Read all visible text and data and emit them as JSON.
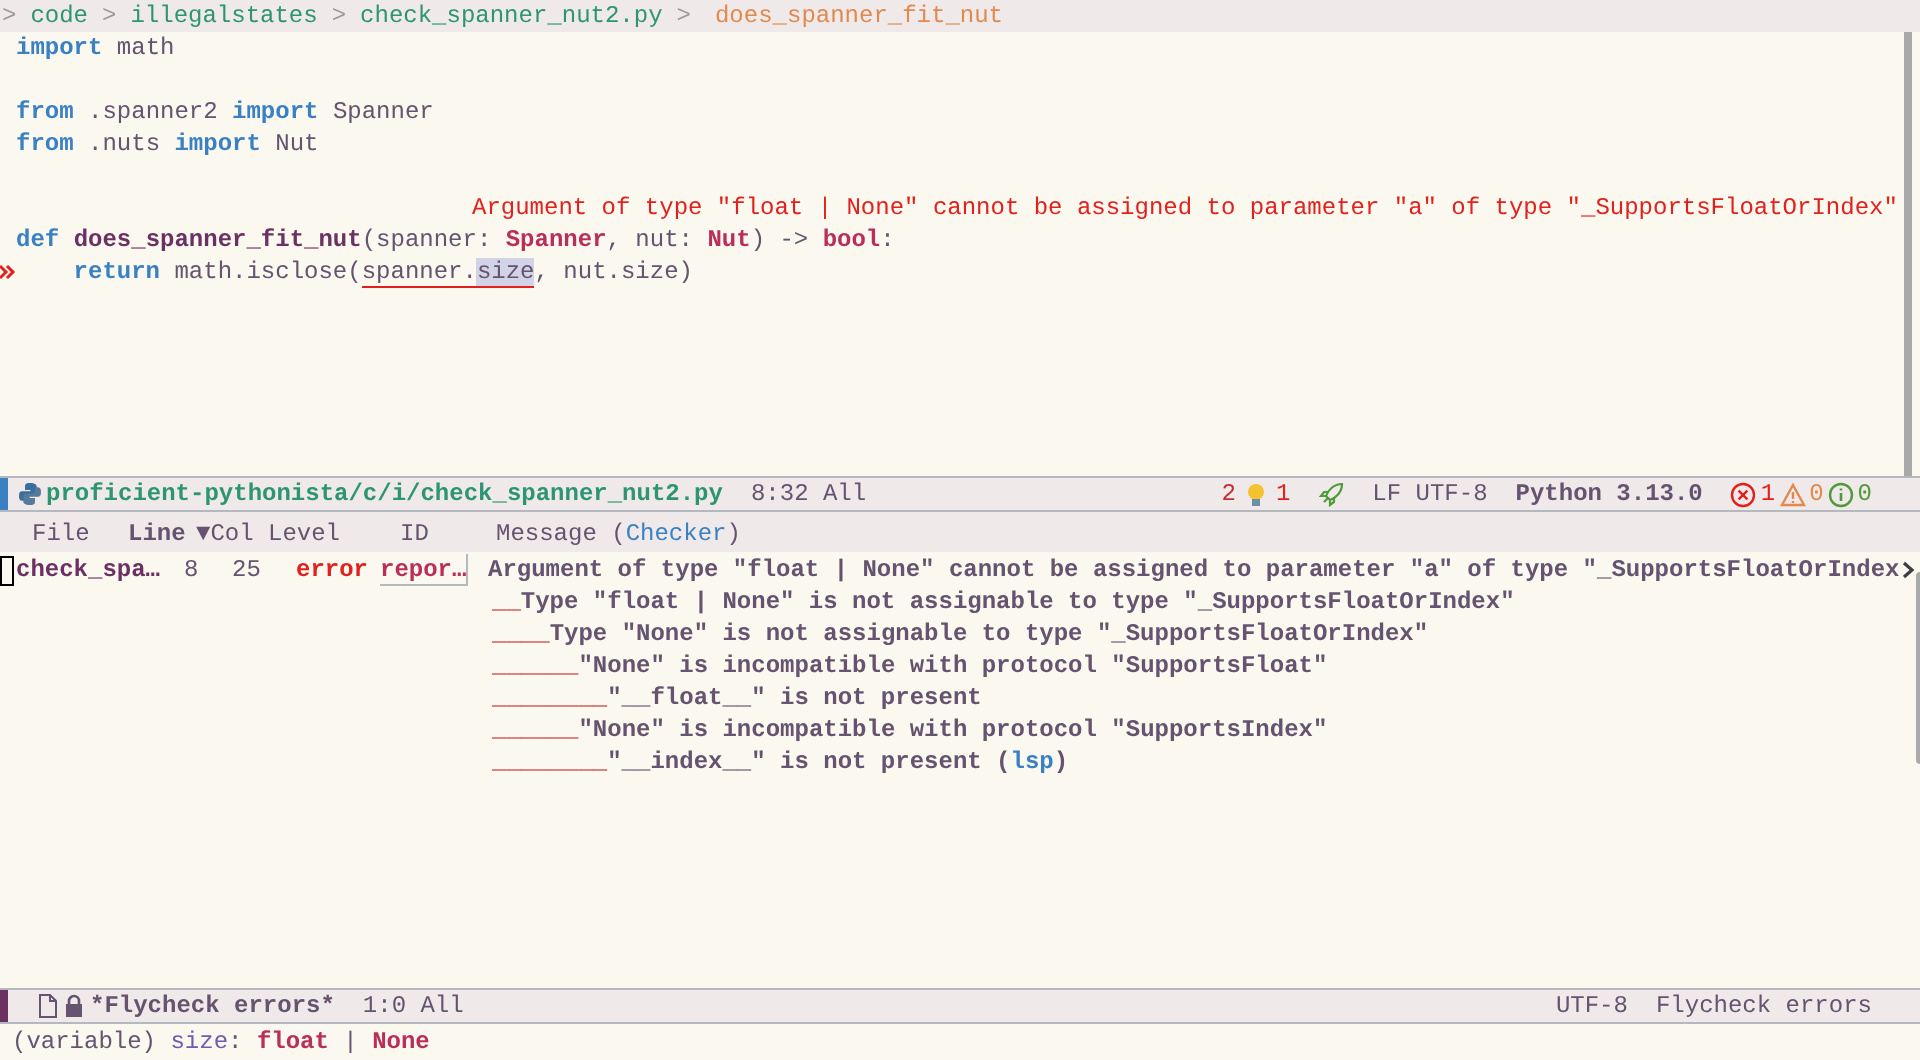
{
  "breadcrumb": [
    {
      "text": ">",
      "kind": "sep"
    },
    {
      "text": "code",
      "kind": "dir"
    },
    {
      "text": ">",
      "kind": "sep"
    },
    {
      "text": "illegalstates",
      "kind": "dir"
    },
    {
      "text": ">",
      "kind": "sep"
    },
    {
      "text": "check_spanner_nut2.py",
      "kind": "dir"
    },
    {
      "text": ">",
      "kind": "sep"
    },
    {
      "text": "does_spanner_fit_nut",
      "kind": "symbol"
    }
  ],
  "code": [
    {
      "kind": "code",
      "marker": false,
      "tokens": [
        {
          "text": "import",
          "kind": "keyword"
        },
        {
          "text": " math",
          "kind": "plain"
        }
      ]
    },
    {
      "kind": "blank"
    },
    {
      "kind": "code",
      "marker": false,
      "tokens": [
        {
          "text": "from",
          "kind": "keyword"
        },
        {
          "text": " .spanner2 ",
          "kind": "plain"
        },
        {
          "text": "import",
          "kind": "keyword"
        },
        {
          "text": " Spanner",
          "kind": "plain"
        }
      ]
    },
    {
      "kind": "code",
      "marker": false,
      "tokens": [
        {
          "text": "from",
          "kind": "keyword"
        },
        {
          "text": " .nuts ",
          "kind": "plain"
        },
        {
          "text": "import",
          "kind": "keyword"
        },
        {
          "text": " Nut",
          "kind": "plain"
        }
      ]
    },
    {
      "kind": "blank"
    },
    {
      "kind": "overlay",
      "text": "Argument of type \"float | None\" cannot be assigned to parameter \"a\" of type \"_SupportsFloatOrIndex\""
    },
    {
      "kind": "code",
      "marker": false,
      "tokens": [
        {
          "text": "def ",
          "kind": "keyword"
        },
        {
          "text": "does_spanner_fit_nut",
          "kind": "function"
        },
        {
          "text": "(spanner: ",
          "kind": "plain"
        },
        {
          "text": "Spanner",
          "kind": "type"
        },
        {
          "text": ", nut: ",
          "kind": "plain"
        },
        {
          "text": "Nut",
          "kind": "type"
        },
        {
          "text": ") -> ",
          "kind": "plain"
        },
        {
          "text": "bool",
          "kind": "type"
        },
        {
          "text": ":",
          "kind": "plain"
        }
      ]
    },
    {
      "kind": "code",
      "marker": true,
      "tokens": [
        {
          "text": "    return",
          "kind": "keyword"
        },
        {
          "text": " math.isclose(",
          "kind": "plain"
        },
        {
          "text": "spanner.",
          "kind": "plain",
          "underlined": true,
          "highlighted": false
        },
        {
          "text": "size",
          "kind": "plain",
          "underlined": true,
          "highlighted": true
        },
        {
          "text": ", nut.size)",
          "kind": "plain"
        }
      ]
    }
  ],
  "mode_line": {
    "path": "proficient-pythonista/c/i/check_spanner_nut2.py",
    "position": "8:32 All",
    "hints": "2",
    "actions": "1",
    "eol_encoding": "LF UTF-8",
    "interpreter": "Python 3.13.0",
    "errors": "1",
    "warnings": "0",
    "infos": "0"
  },
  "table": {
    "columns": [
      {
        "label": "File",
        "bold": false
      },
      {
        "label": "Line",
        "bold": true
      },
      {
        "label": "Col",
        "bold": false,
        "sort": "▼"
      },
      {
        "label": "Level",
        "bold": false
      },
      {
        "label": "ID",
        "bold": false
      }
    ],
    "message_column": [
      {
        "text": "Message (",
        "kind": "header"
      },
      {
        "text": "Checker",
        "kind": "link"
      },
      {
        "text": ")",
        "kind": "header"
      }
    ],
    "rows": [
      {
        "file": "check_spa…",
        "line": "8",
        "col": "25",
        "level": "error",
        "id": "repor…",
        "message": "Argument of type \"float | None\" cannot be assigned to parameter \"a\" of type \"_SupportsFloatOrIndex",
        "truncated": true,
        "details": [
          {
            "indent": "__",
            "parts": [
              {
                "text": "Type \"float | None\" is not assignable to type \"_SupportsFloatOrIndex\"",
                "kind": "text"
              }
            ]
          },
          {
            "indent": "____",
            "parts": [
              {
                "text": "Type \"None\" is not assignable to type \"_SupportsFloatOrIndex\"",
                "kind": "text"
              }
            ]
          },
          {
            "indent": "______",
            "parts": [
              {
                "text": "\"None\" is incompatible with protocol \"SupportsFloat\"",
                "kind": "text"
              }
            ]
          },
          {
            "indent": "________",
            "parts": [
              {
                "text": "\"__float__\" is not present",
                "kind": "text"
              }
            ]
          },
          {
            "indent": "______",
            "parts": [
              {
                "text": "\"None\" is incompatible with protocol \"SupportsIndex\"",
                "kind": "text"
              }
            ]
          },
          {
            "indent": "________",
            "parts": [
              {
                "text": "\"__index__\" is not present (",
                "kind": "text"
              },
              {
                "text": "lsp",
                "kind": "link"
              },
              {
                "text": ")",
                "kind": "text"
              }
            ]
          }
        ]
      }
    ]
  },
  "list_mode_line": {
    "buffer": "*Flycheck errors*",
    "position": "1:0 All",
    "encoding": "UTF-8",
    "mode": "Flycheck errors"
  },
  "echo": [
    {
      "text": "(variable) ",
      "kind": "plain"
    },
    {
      "text": "size",
      "kind": "variable"
    },
    {
      "text": ": ",
      "kind": "plain"
    },
    {
      "text": "float",
      "kind": "type"
    },
    {
      "text": " | ",
      "kind": "plain"
    },
    {
      "text": "None",
      "kind": "type"
    }
  ]
}
